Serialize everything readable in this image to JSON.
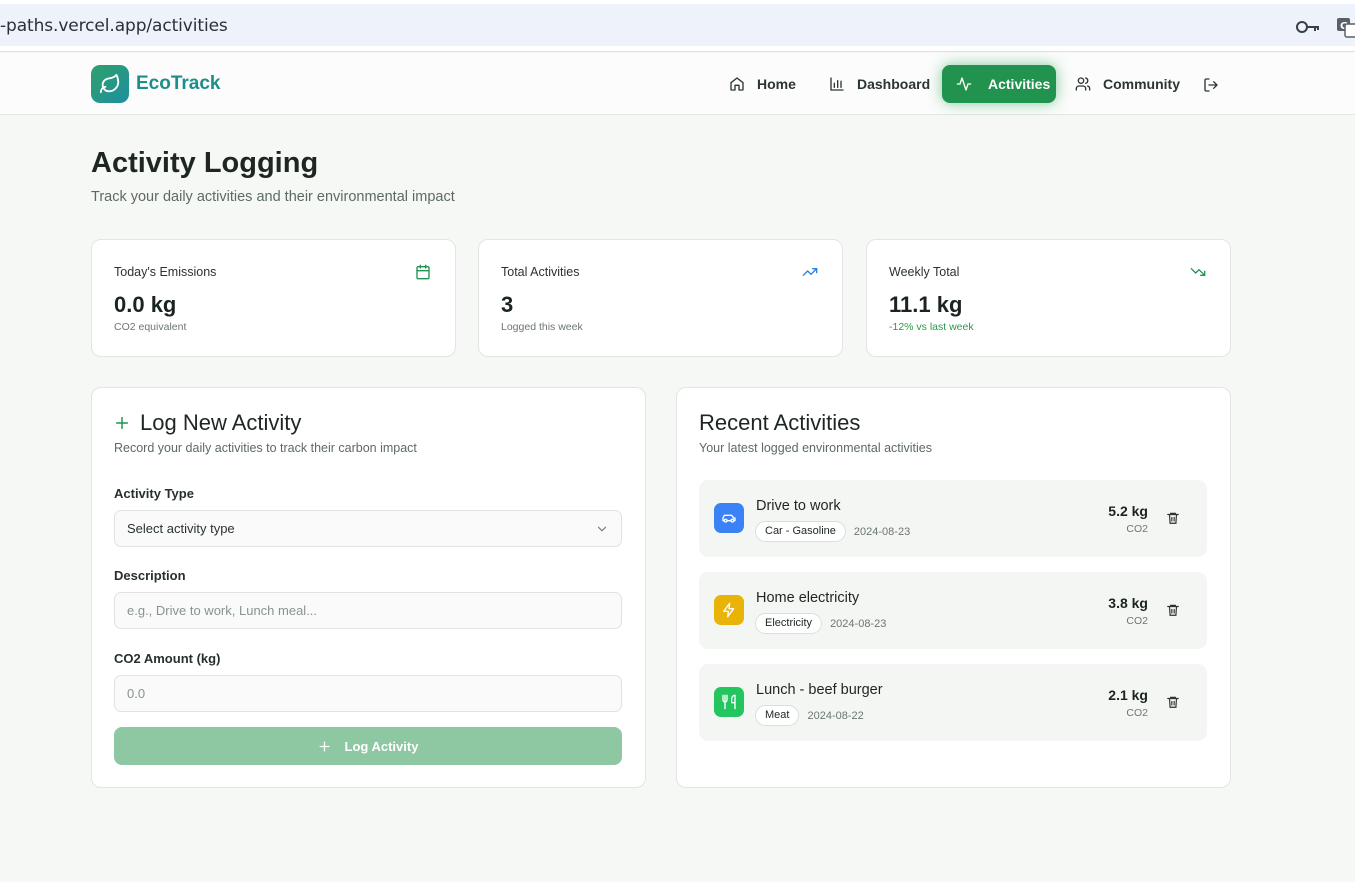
{
  "browser": {
    "url": "-paths.vercel.app/activities"
  },
  "header": {
    "brand": "EcoTrack",
    "nav": [
      {
        "label": "Home",
        "icon": "home-icon"
      },
      {
        "label": "Dashboard",
        "icon": "bar-chart-icon"
      },
      {
        "label": "Activities",
        "icon": "activity-pulse-icon",
        "active": true
      },
      {
        "label": "Community",
        "icon": "users-icon"
      }
    ],
    "logout_icon": "logout-icon"
  },
  "page": {
    "title": "Activity Logging",
    "subtitle": "Track your daily activities and their environmental impact"
  },
  "stats": [
    {
      "label": "Today's Emissions",
      "value": "0.0 kg",
      "sub": "CO2 equivalent",
      "icon": "calendar-icon"
    },
    {
      "label": "Total Activities",
      "value": "3",
      "sub": "Logged this week",
      "icon": "trending-up-icon"
    },
    {
      "label": "Weekly Total",
      "value": "11.1 kg",
      "sub": "-12% vs last week",
      "icon": "trending-down-icon"
    }
  ],
  "log_form": {
    "title": "Log New Activity",
    "subtitle": "Record your daily activities to track their carbon impact",
    "activity_type_label": "Activity Type",
    "activity_type_value": "Select activity type",
    "description_label": "Description",
    "description_placeholder": "e.g., Drive to work, Lunch meal...",
    "co2_label": "CO2 Amount (kg)",
    "co2_placeholder": "0.0",
    "submit_label": "Log Activity"
  },
  "recent": {
    "title": "Recent Activities",
    "subtitle": "Your latest logged environmental activities",
    "items": [
      {
        "title": "Drive to work",
        "tag": "Car - Gasoline",
        "date": "2024-08-23",
        "amount": "5.2 kg",
        "unit": "CO2",
        "icon": "car-icon",
        "color": "#3b82f6"
      },
      {
        "title": "Home electricity",
        "tag": "Electricity",
        "date": "2024-08-23",
        "amount": "3.8 kg",
        "unit": "CO2",
        "icon": "lightning-icon",
        "color": "#eab308"
      },
      {
        "title": "Lunch - beef burger",
        "tag": "Meat",
        "date": "2024-08-22",
        "amount": "2.1 kg",
        "unit": "CO2",
        "icon": "utensils-icon",
        "color": "#22c55e"
      }
    ]
  },
  "colors": {
    "accent": "#22924f",
    "brand": "#1d8f8a",
    "button_disabled": "#8dc8a3"
  }
}
